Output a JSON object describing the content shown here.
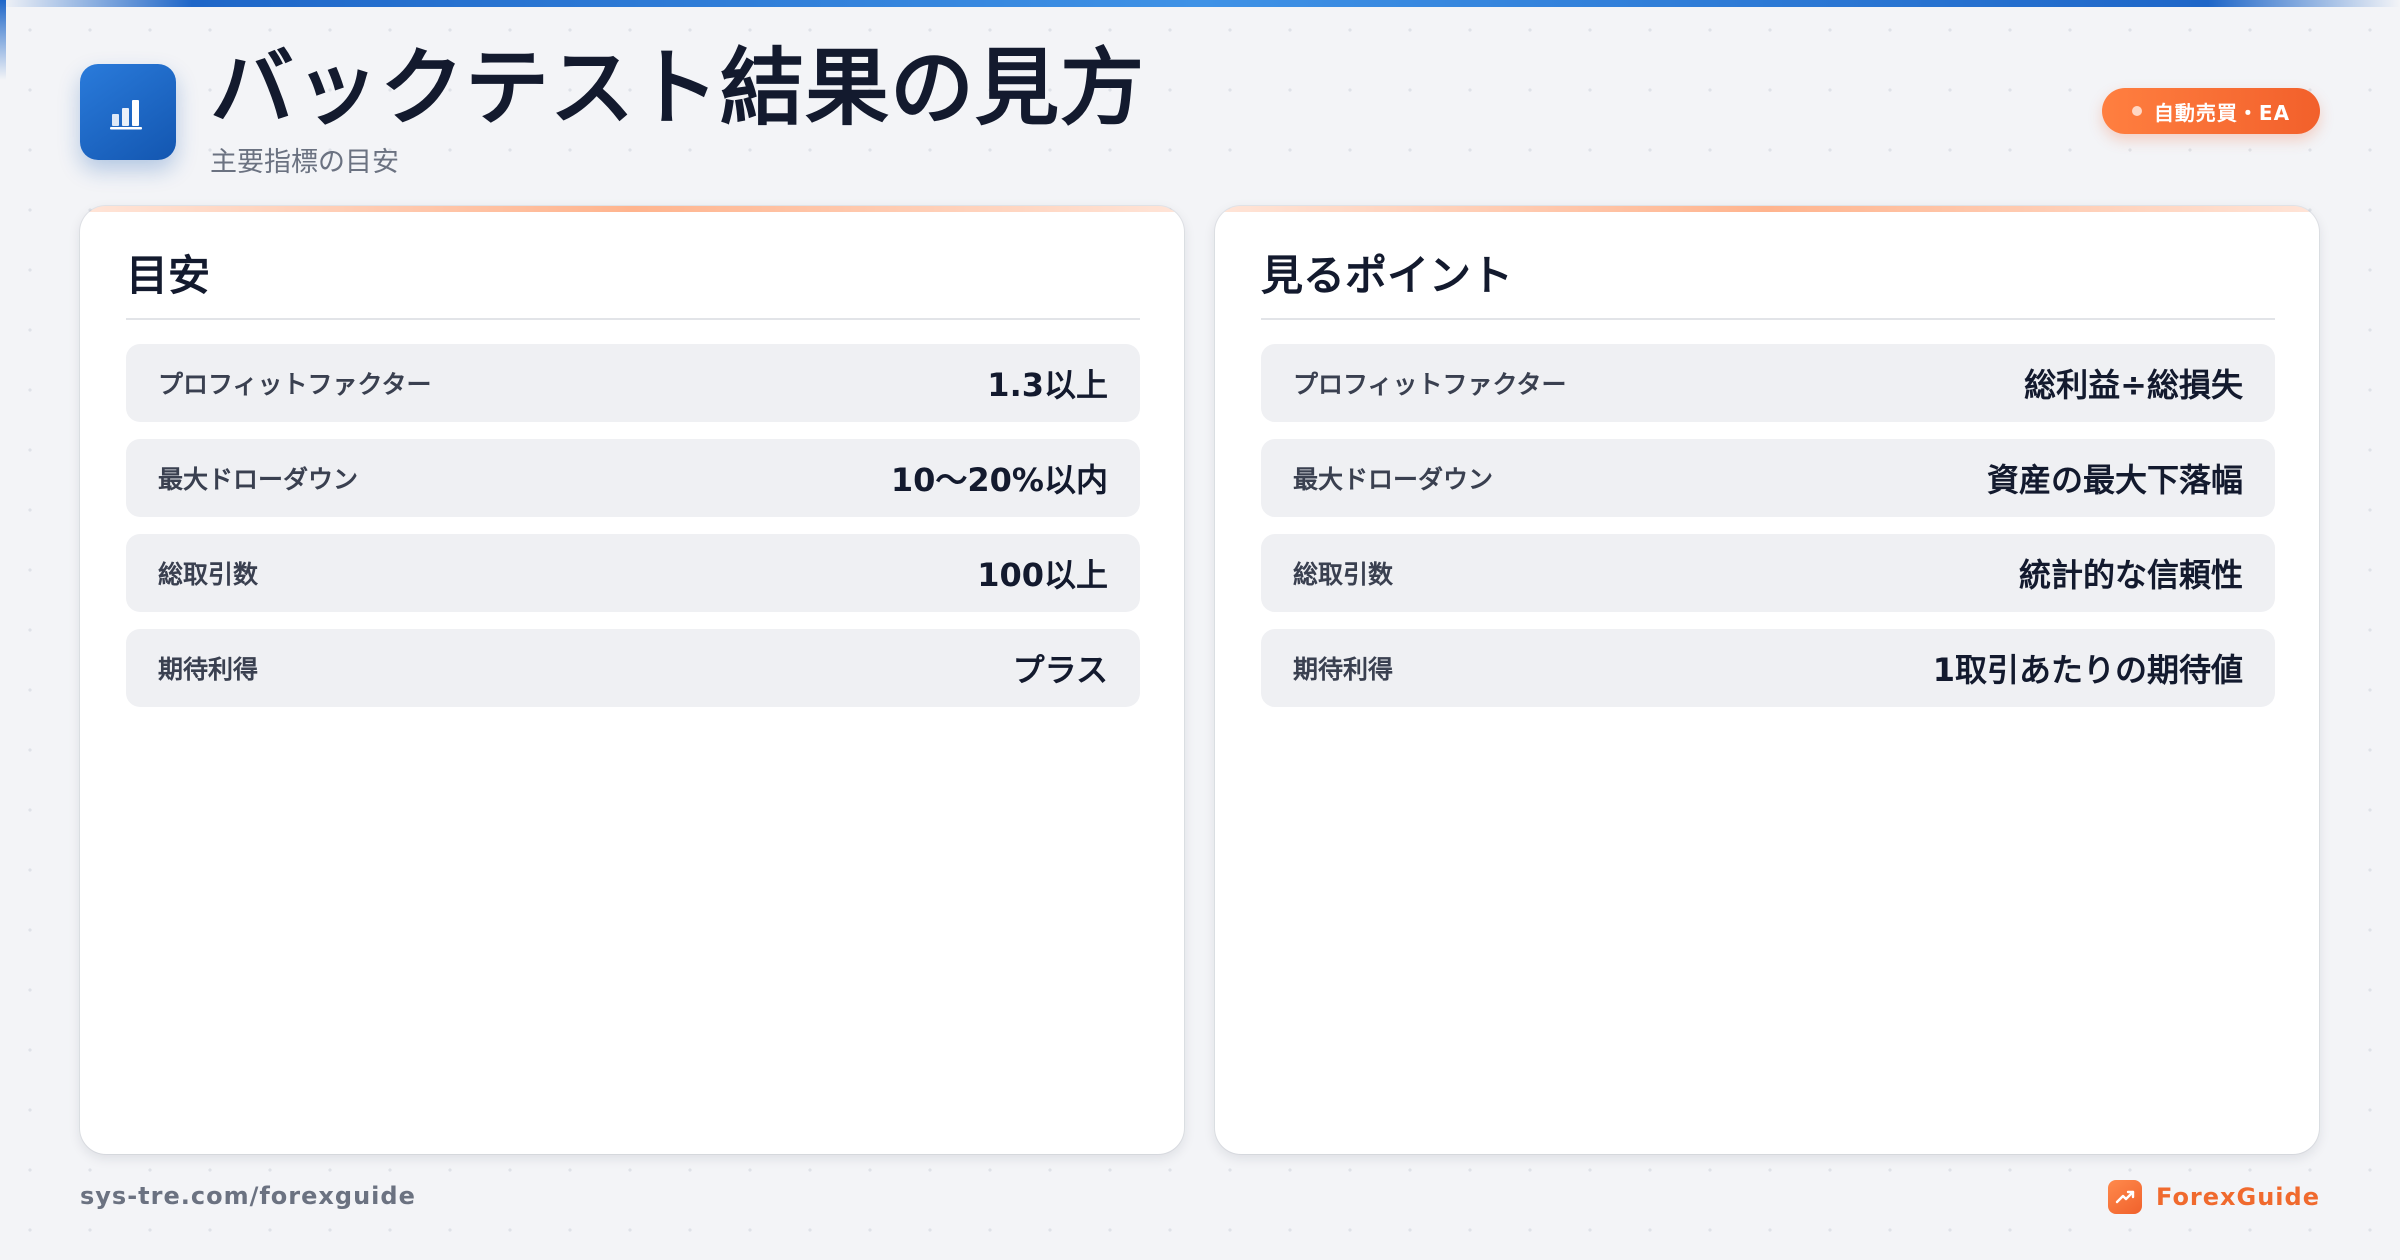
{
  "header": {
    "title": "バックテスト結果の見方",
    "subtitle": "主要指標の目安",
    "tag": "自動売買・EA",
    "logo_icon": "bar-chart-icon"
  },
  "cards": [
    {
      "title": "目安",
      "rows": [
        {
          "label": "プロフィットファクター",
          "value": "1.3以上"
        },
        {
          "label": "最大ドローダウン",
          "value": "10〜20%以内"
        },
        {
          "label": "総取引数",
          "value": "100以上"
        },
        {
          "label": "期待利得",
          "value": "プラス"
        }
      ]
    },
    {
      "title": "見るポイント",
      "rows": [
        {
          "label": "プロフィットファクター",
          "value": "総利益÷総損失"
        },
        {
          "label": "最大ドローダウン",
          "value": "資産の最大下落幅"
        },
        {
          "label": "総取引数",
          "value": "統計的な信頼性"
        },
        {
          "label": "期待利得",
          "value": "1取引あたりの期待値"
        }
      ]
    }
  ],
  "footer": {
    "url": "sys-tre.com/forexguide",
    "brand": "ForexGuide",
    "brand_icon": "trending-up-icon"
  },
  "colors": {
    "primary": "#1e66c8",
    "accent": "#f2602b",
    "text": "#131a2e"
  }
}
